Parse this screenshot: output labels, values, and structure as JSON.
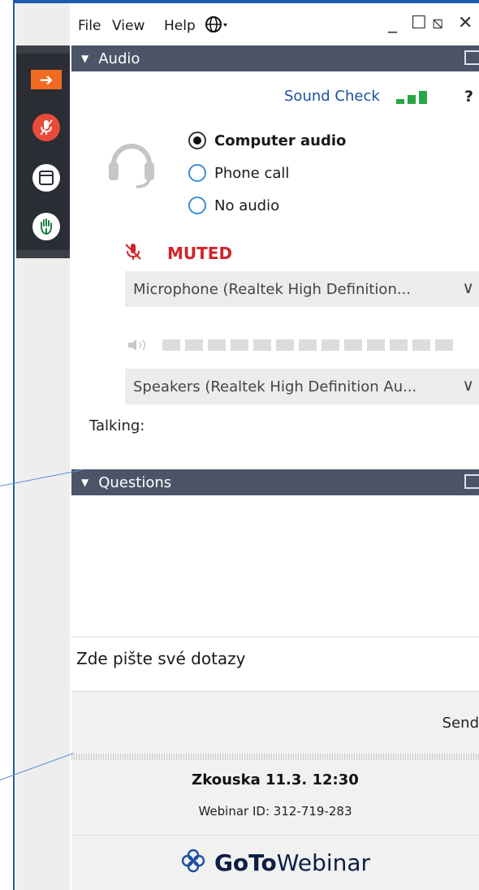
{
  "menu": {
    "file": "File",
    "view": "View",
    "help": "Help"
  },
  "window": {
    "minimize": "_",
    "maximize": "☐",
    "restore": "⧅",
    "close": "✕"
  },
  "audio": {
    "title": "Audio",
    "sound_check": "Sound Check",
    "help": "?",
    "options": [
      {
        "label": "Computer audio",
        "selected": true
      },
      {
        "label": "Phone call",
        "selected": false
      },
      {
        "label": "No audio",
        "selected": false
      }
    ],
    "muted_label": "MUTED",
    "microphone": "Microphone (Realtek High Definition...",
    "speakers": "Speakers (Realtek High Definition Au...",
    "talking_label": "Talking:"
  },
  "questions": {
    "title": "Questions",
    "placeholder": "Zde pište své dotazy",
    "send_label": "Send"
  },
  "webinar": {
    "name": "Zkouska 11.3. 12:30",
    "id_line": "Webinar ID: 312-719-283",
    "logo_goto": "GoTo",
    "logo_webinar": "Webinar"
  },
  "icons": {
    "share": "arrow-right-icon",
    "mic": "microphone-icon",
    "window": "window-icon",
    "hand": "raise-hand-icon"
  },
  "colors": {
    "header": "#4c5568",
    "accent_blue": "#1f5aa8",
    "muted_red": "#d1242a",
    "signal_green": "#27a744",
    "share_orange": "#f26a21"
  }
}
